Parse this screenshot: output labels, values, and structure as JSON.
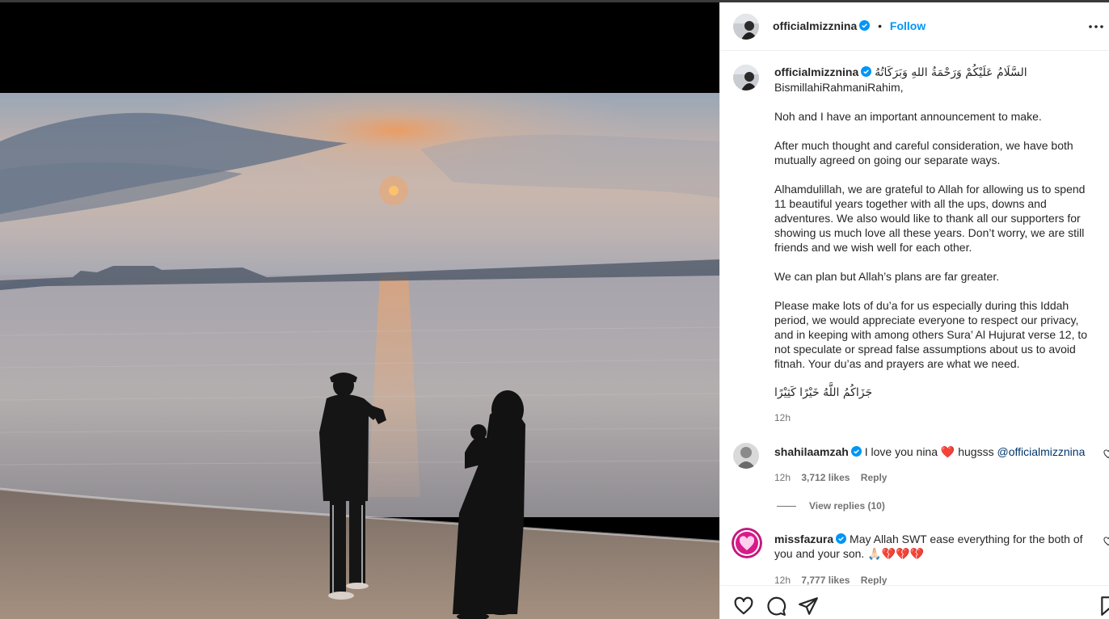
{
  "post": {
    "author": "officialmizznina",
    "follow_label": "Follow",
    "separator": "•",
    "more_icon": "more-horizontal-icon"
  },
  "caption": {
    "lines": [
      "السَّلَامُ عَلَيْكُمْ وَرَحْمَةُ اللهِ وَبَرَكَاتُهُ",
      "BismillahiRahmaniRahim,",
      "",
      "Noh and I have an important announcement to make.",
      "",
      "After much thought and careful consideration, we have both mutually agreed on going our separate ways.",
      "",
      "Alhamdulillah, we are grateful to Allah for allowing us to spend 11 beautiful years together with all the ups, downs and adventures. We also would like to thank all our supporters for showing us much love all these years. Don’t worry, we are still friends and we wish well for each other.",
      "",
      "We can plan but Allah’s plans are far greater.",
      "",
      "Please make lots of du’a for us especially during this Iddah period, we would appreciate everyone to respect our privacy, and in keeping with among others Sura’ Al Hujurat verse 12, to not speculate or spread false assumptions about us to avoid fitnah. Your du’as and prayers are what we need.",
      "",
      "جَزَاكُمُ اللَّهُ خَيْرًا كَثِيْرًا"
    ],
    "time": "12h"
  },
  "comments": [
    {
      "user": "shahilaamzah",
      "text_before": "I love you nina",
      "emoji_heart": "❤️",
      "text_after": "hugsss",
      "mention": "@officialmizznina",
      "time": "12h",
      "likes": "3,712 likes",
      "reply": "Reply",
      "view_replies": "View replies (10)"
    },
    {
      "user": "missfazura",
      "text": "May Allah SWT ease everything for the both of you and your son.",
      "emojis": "🙏🏻💔💔💔",
      "time": "12h",
      "likes": "7,777 likes",
      "reply": "Reply"
    }
  ],
  "actions": [
    "like-icon",
    "comment-icon",
    "share-icon",
    "save-icon"
  ],
  "colors": {
    "link": "#0095f6",
    "mention": "#00376b",
    "verified": "#0095f6",
    "heart": "#ed4956"
  }
}
